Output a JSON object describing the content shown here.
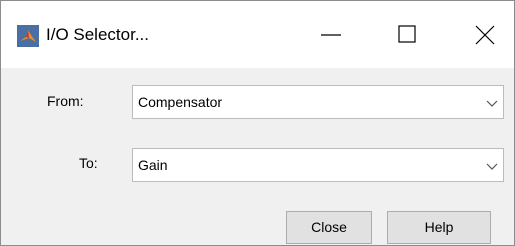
{
  "window": {
    "title": "I/O Selector...",
    "icon": "matlab-icon",
    "controls": [
      "minimize-icon",
      "maximize-icon",
      "close-icon"
    ]
  },
  "form": {
    "from_label": "From:",
    "from_value": "Compensator",
    "to_label": "To:",
    "to_value": "Gain"
  },
  "buttons": {
    "close_label": "Close",
    "help_label": "Help"
  },
  "colors": {
    "titlebar_bg": "#ffffff",
    "dialog_bg": "#f0f0f0",
    "button_bg": "#e1e1e1",
    "combo_border": "#bcbcbc"
  }
}
